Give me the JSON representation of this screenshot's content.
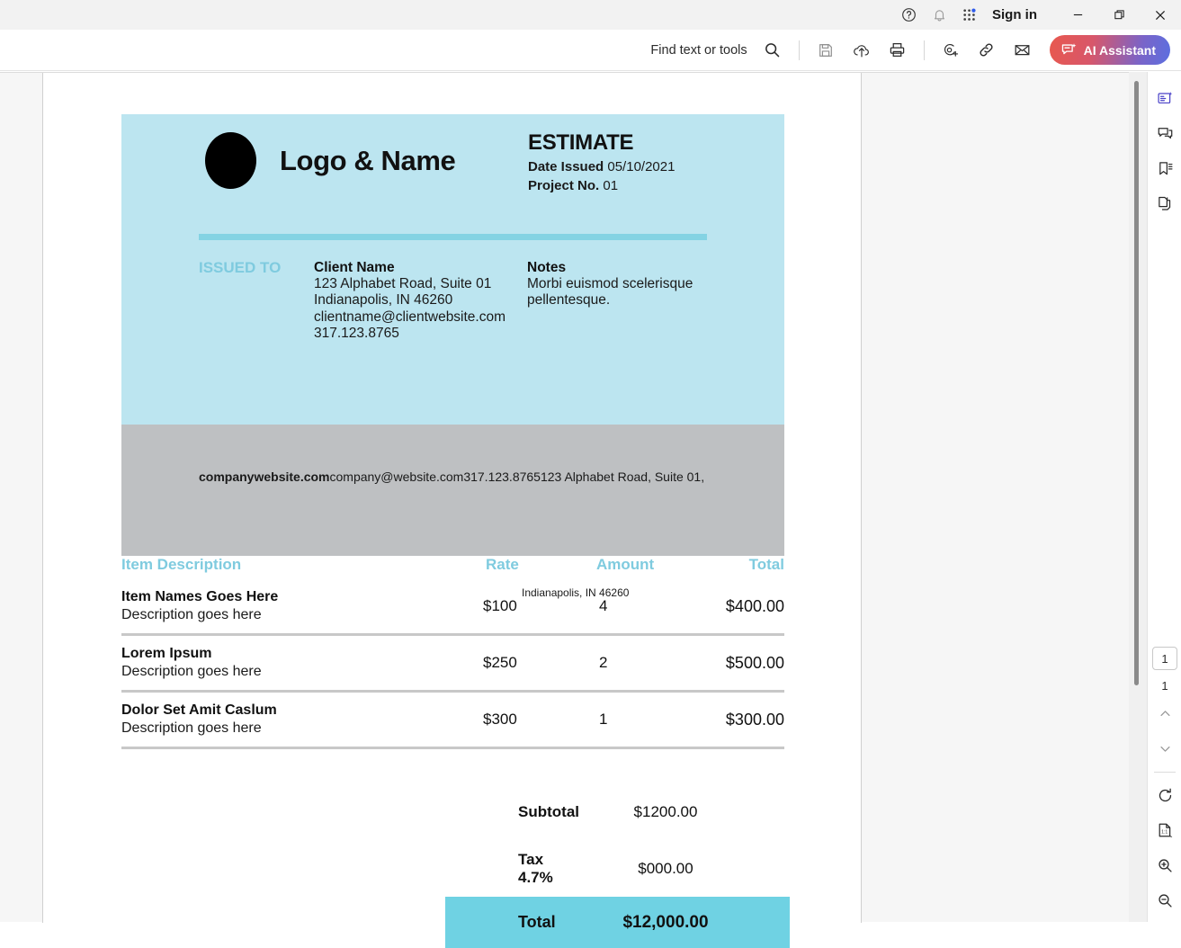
{
  "titlebar": {
    "icons": [
      "help-icon",
      "notifications-bell-icon",
      "apps-grid-icon"
    ],
    "sign_in_label": "Sign in",
    "window_buttons": [
      "minimize",
      "restore",
      "close"
    ]
  },
  "toolbar": {
    "find_label": "Find text or tools",
    "search_icon": "search-icon",
    "icons": [
      "save-icon",
      "upload-cloud-icon",
      "print-icon",
      "add-stamp-icon",
      "link-icon",
      "email-icon"
    ],
    "ai_assistant_label": "AI Assistant",
    "ai_assistant_icon": "ai-sparkle-chat-icon",
    "ai_gradient_from": "#e8584e",
    "ai_gradient_to": "#5b6fe0"
  },
  "document": {
    "theme": {
      "hero_bg": "#bce5f0",
      "gray_bg": "#bec0c2",
      "accent": "#7fcbdf",
      "rule": "#84d3e3",
      "total_bar": "#6fd2e3"
    },
    "logo_name": "Logo & Name",
    "doc_type": "ESTIMATE",
    "date_issued_label": "Date Issued",
    "date_issued_value": "05/10/2021",
    "project_no_label": "Project No.",
    "project_no_value": "01",
    "issued_to_label": "ISSUED TO",
    "client": {
      "title": "Client Name",
      "lines": [
        "123 Alphabet Road, Suite 01",
        "Indianapolis, IN 46260",
        "clientname@clientwebsite.com",
        "317.123.8765"
      ]
    },
    "notes": {
      "title": "Notes",
      "text": "Morbi euismod scelerisque pellentesque."
    },
    "company_footer": {
      "website": "companywebsite.com",
      "rest": "company@website.com317.123.8765123 Alphabet Road, Suite 01,"
    },
    "table": {
      "headers": {
        "description": "Item Description",
        "rate": "Rate",
        "amount": "Amount",
        "total": "Total"
      },
      "overlap_artifact": "Indianapolis, IN 46260",
      "rows": [
        {
          "name": "Item Names Goes Here",
          "description": "Description goes here",
          "rate": "$100",
          "amount": "4",
          "total": "$400.00"
        },
        {
          "name": "Lorem Ipsum",
          "description": "Description goes here",
          "rate": "$250",
          "amount": "2",
          "total": "$500.00"
        },
        {
          "name": "Dolor Set Amit Caslum",
          "description": "Description goes here",
          "rate": "$300",
          "amount": "1",
          "total": "$300.00"
        }
      ]
    },
    "totals": {
      "subtotal_label": "Subtotal",
      "subtotal_value": "$1200.00",
      "tax_label": "Tax 4.7%",
      "tax_value": "$000.00",
      "total_label": "Total",
      "total_value": "$12,000.00"
    }
  },
  "rail": {
    "top_icons": [
      "fill-and-sign-icon",
      "comment-icon",
      "bookmark-icon",
      "pages-copy-icon"
    ],
    "page_number": "1",
    "page_count": "1",
    "bottom_icons": [
      "chevron-up-icon",
      "chevron-down-icon",
      "rotate-icon",
      "fit-page-icon",
      "zoom-in-icon",
      "zoom-out-icon"
    ]
  }
}
